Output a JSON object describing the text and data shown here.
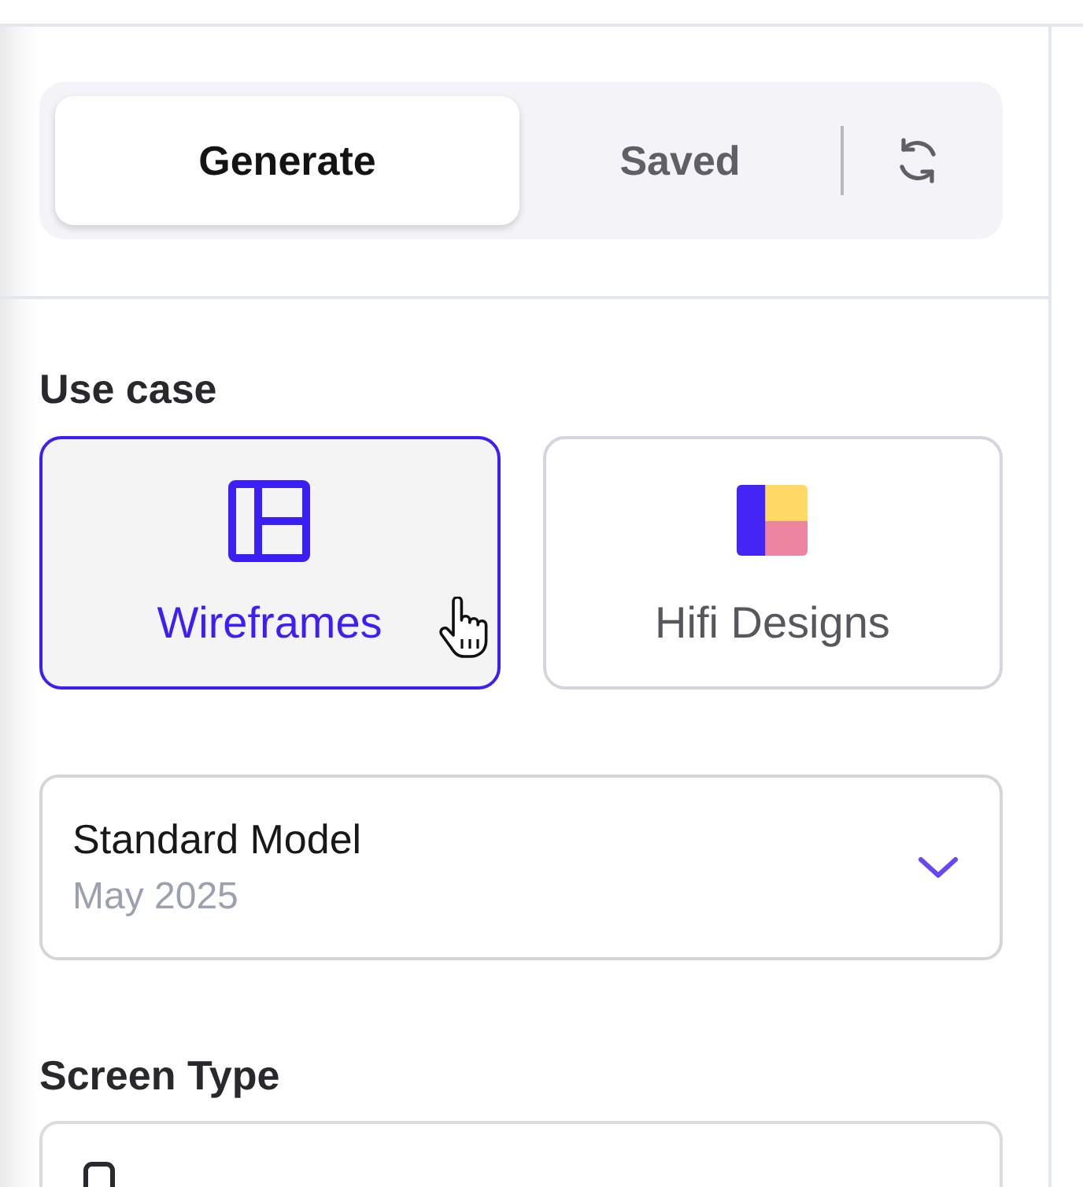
{
  "tabs": [
    {
      "label": "Generate",
      "selected": true
    },
    {
      "label": "Saved",
      "selected": false
    }
  ],
  "use_case": {
    "label": "Use case",
    "options": [
      {
        "label": "Wireframes",
        "kind": "wireframe",
        "selected": true
      },
      {
        "label": "Hifi Designs",
        "kind": "hifi",
        "selected": false
      }
    ]
  },
  "model_select": {
    "value": "Standard Model",
    "subtitle": "May 2025"
  },
  "screen_type": {
    "label": "Screen Type"
  }
}
